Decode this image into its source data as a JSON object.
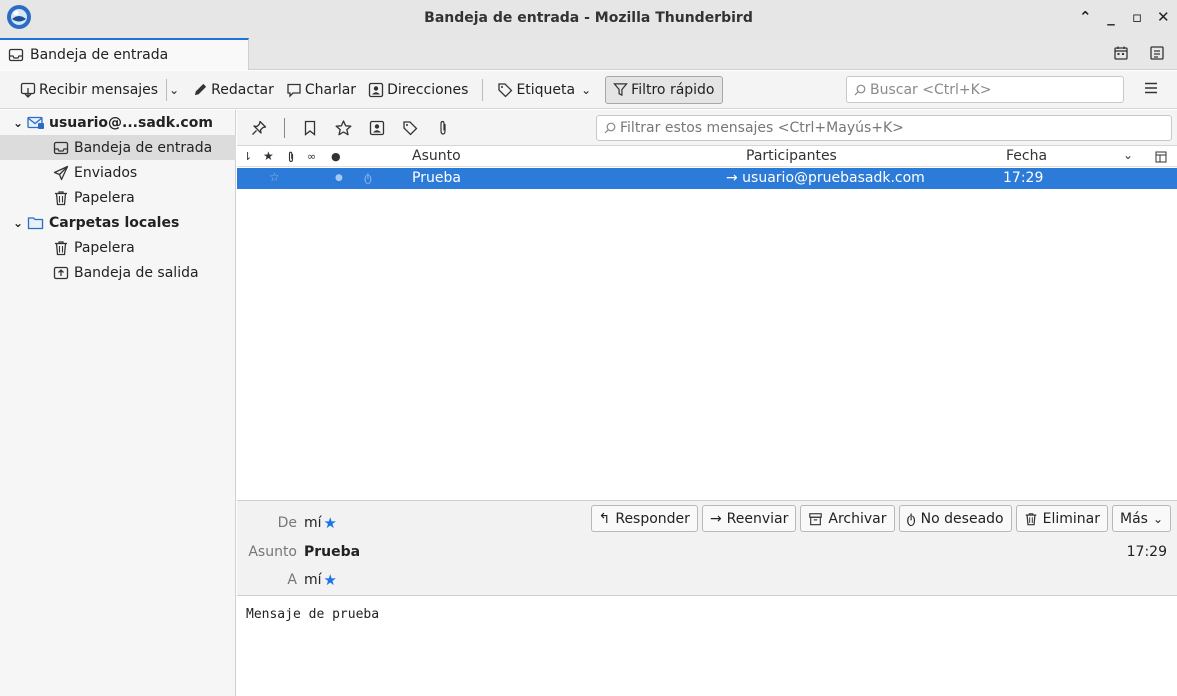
{
  "window": {
    "title": "Bandeja de entrada - Mozilla Thunderbird",
    "controls": [
      "^",
      "_",
      "□",
      "×"
    ]
  },
  "tabs": [
    {
      "label": "Bandeja de entrada",
      "icon": "inbox-icon",
      "active": true
    }
  ],
  "toolbar": {
    "get_messages": "Recibir mensajes",
    "compose": "Redactar",
    "chat": "Charlar",
    "address_book": "Direcciones",
    "tag": "Etiqueta",
    "quick_filter": "Filtro rápido",
    "search_placeholder": "Buscar <Ctrl+K>"
  },
  "folders": {
    "account": "usuario@...sadk.com",
    "items": [
      {
        "label": "Bandeja de entrada",
        "icon": "inbox-icon",
        "selected": true
      },
      {
        "label": "Enviados",
        "icon": "send-icon"
      },
      {
        "label": "Papelera",
        "icon": "trash-icon"
      }
    ],
    "local_folders": "Carpetas locales",
    "local_items": [
      {
        "label": "Papelera",
        "icon": "trash-icon"
      },
      {
        "label": "Bandeja de salida",
        "icon": "outbox-icon"
      }
    ]
  },
  "quick_filter": {
    "placeholder": "Filtrar estos mensajes <Ctrl+Mayús+K>"
  },
  "thread_columns": {
    "subject": "Asunto",
    "participants": "Participantes",
    "date": "Fecha"
  },
  "messages": [
    {
      "subject": "Prueba",
      "participants": "→ usuario@pruebasadk.com",
      "date": "17:29",
      "selected": true
    }
  ],
  "message_header": {
    "from_label": "De",
    "from_value": "mí",
    "subject_label": "Asunto",
    "subject_value": "Prueba",
    "to_label": "A",
    "to_value": "mí",
    "time": "17:29",
    "actions": {
      "reply": "Responder",
      "forward": "Reenviar",
      "archive": "Archivar",
      "junk": "No deseado",
      "delete": "Eliminar",
      "more": "Más"
    }
  },
  "message_body": "Mensaje de prueba",
  "colors": {
    "accent": "#1e72d8",
    "selection": "#2d7bd8",
    "star": "#1a73e8"
  }
}
